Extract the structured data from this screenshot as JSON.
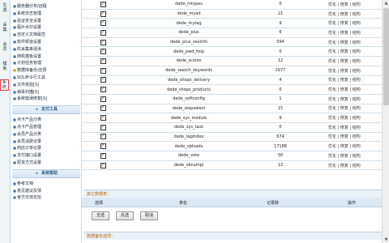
{
  "vertical_tabs": [
    "生成",
    "采集",
    "会员",
    "模板",
    "系统"
  ],
  "sidebar": {
    "items_top": [
      {
        "label": "服务器分布/远程"
      },
      {
        "label": "系统日志管理"
      },
      {
        "label": "验证安全设置"
      },
      {
        "label": "图片水印设置"
      },
      {
        "label": "自定义文档属性"
      },
      {
        "label": "软件频道设置"
      },
      {
        "label": "防采集串混淆"
      },
      {
        "label": "随机模板设置"
      },
      {
        "label": "计划任务管理"
      },
      {
        "label": "数据库备份/还原"
      },
      {
        "label": "SQL命令行工具"
      },
      {
        "label": "文件校验[S]"
      },
      {
        "label": "病毒扫描[S]"
      },
      {
        "label": "系统错误修复[S]"
      }
    ],
    "section_payment": "支付工具",
    "items_payment": [
      {
        "label": "点卡产品分类"
      },
      {
        "label": "点卡产品管理"
      },
      {
        "label": "会员产品分类"
      },
      {
        "label": "会员消费记录"
      },
      {
        "label": "商店订单记录"
      },
      {
        "label": "支付接口设置"
      },
      {
        "label": "配货方式设置"
      }
    ],
    "section_help": "系统帮助",
    "items_help": [
      {
        "label": "参考文档"
      },
      {
        "label": "意见建议反馈"
      },
      {
        "label": "官方交流论坛"
      }
    ]
  },
  "table_rows": [
    {
      "name": "dede_mtypes",
      "count": "0",
      "ops": "优化 | 修复 | 结构"
    },
    {
      "name": "dede_myad",
      "count": "21",
      "ops": "优化 | 修复 | 结构"
    },
    {
      "name": "dede_mytag",
      "count": "9",
      "ops": "优化 | 修复 | 结构"
    },
    {
      "name": "dede_plus",
      "count": "6",
      "ops": "优化 | 修复 | 结构"
    },
    {
      "name": "dede_plus_seoinfo",
      "count": "594",
      "ops": "优化 | 修复 | 结构"
    },
    {
      "name": "dede_pwd_tmp",
      "count": "0",
      "ops": "优化 | 修复 | 结构"
    },
    {
      "name": "dede_scores",
      "count": "12",
      "ops": "优化 | 修复 | 结构"
    },
    {
      "name": "dede_search_keywords",
      "count": "2977",
      "ops": "优化 | 修复 | 结构"
    },
    {
      "name": "dede_shops_delivery",
      "count": "4",
      "ops": "优化 | 修复 | 结构"
    },
    {
      "name": "dede_shops_products",
      "count": "0",
      "ops": "优化 | 修复 | 结构"
    },
    {
      "name": "dede_softconfig",
      "count": "1",
      "ops": "优化 | 修复 | 结构"
    },
    {
      "name": "dede_stepselect",
      "count": "15",
      "ops": "优化 | 修复 | 结构"
    },
    {
      "name": "dede_sys_module",
      "count": "9",
      "ops": "优化 | 修复 | 结构"
    },
    {
      "name": "dede_sys_task",
      "count": "0",
      "ops": "优化 | 修复 | 结构"
    },
    {
      "name": "dede_tagindex",
      "count": "674",
      "ops": "优化 | 修复 | 结构"
    },
    {
      "name": "dede_uploads",
      "count": "17188",
      "ops": "优化 | 修复 | 结构"
    },
    {
      "name": "dede_vote",
      "count": "50",
      "ops": "优化 | 修复 | 结构"
    },
    {
      "name": "dede_sbnumpi",
      "count": "12",
      "ops": "优化 | 修复 | 结构"
    }
  ],
  "other_section": {
    "title": "其它数据表：",
    "headers": {
      "select": "选择",
      "table": "表名",
      "count": "记录数",
      "ops": "操作"
    }
  },
  "buttons": {
    "select_all": "全选",
    "invert": "反选",
    "cancel": "取消"
  },
  "backup_section": {
    "title": "数据备份选项："
  },
  "colors": {
    "accent": "#2d5b8a",
    "section_title": "#c06000",
    "row_border": "#cfe0ec"
  }
}
